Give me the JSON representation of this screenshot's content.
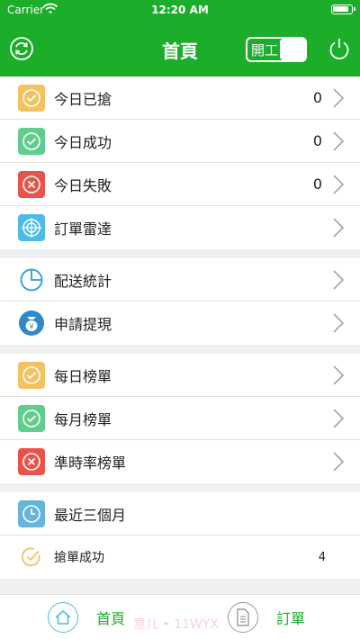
{
  "status": {
    "carrier": "Carrier",
    "time": "12:20 AM"
  },
  "nav": {
    "title": "首頁",
    "toggle_label": "開工"
  },
  "groups": [
    [
      {
        "name": "today-grabbed",
        "label": "今日已搶",
        "value": "0",
        "icon": "check-circle-icon",
        "color": "#f3c263"
      },
      {
        "name": "today-success",
        "label": "今日成功",
        "value": "0",
        "icon": "check-circle-icon",
        "color": "#60cd8e"
      },
      {
        "name": "today-failed",
        "label": "今日失敗",
        "value": "0",
        "icon": "x-circle-icon",
        "color": "#e9534c"
      },
      {
        "name": "order-radar",
        "label": "訂單雷達",
        "value": "",
        "icon": "radar-icon",
        "color": "#4ebbe7"
      }
    ],
    [
      {
        "name": "delivery-stats",
        "label": "配送統計",
        "value": "",
        "icon": "pie-chart-icon",
        "color": "#3aa7df"
      },
      {
        "name": "withdraw",
        "label": "申請提現",
        "value": "",
        "icon": "money-bag-icon",
        "color": "#2f88c8"
      }
    ],
    [
      {
        "name": "daily-ranking",
        "label": "每日榜單",
        "value": "",
        "icon": "check-circle-icon",
        "color": "#f3c263"
      },
      {
        "name": "monthly-ranking",
        "label": "每月榜單",
        "value": "",
        "icon": "check-circle-icon",
        "color": "#60cd8e"
      },
      {
        "name": "ontime-ranking",
        "label": "準時率榜單",
        "value": "",
        "icon": "x-circle-icon",
        "color": "#e9534c"
      }
    ]
  ],
  "recent": {
    "header": {
      "label": "最近三個月",
      "icon": "clock-icon",
      "color": "#66b3dc"
    },
    "rows": [
      {
        "label": "搶單成功",
        "value": "4",
        "icon": "check-circle-outline-icon",
        "color": "#f3c263"
      }
    ]
  },
  "tabbar": {
    "home_label": "首頁",
    "orders_label": "訂單",
    "watermark": "意儿 • 11WYX"
  }
}
